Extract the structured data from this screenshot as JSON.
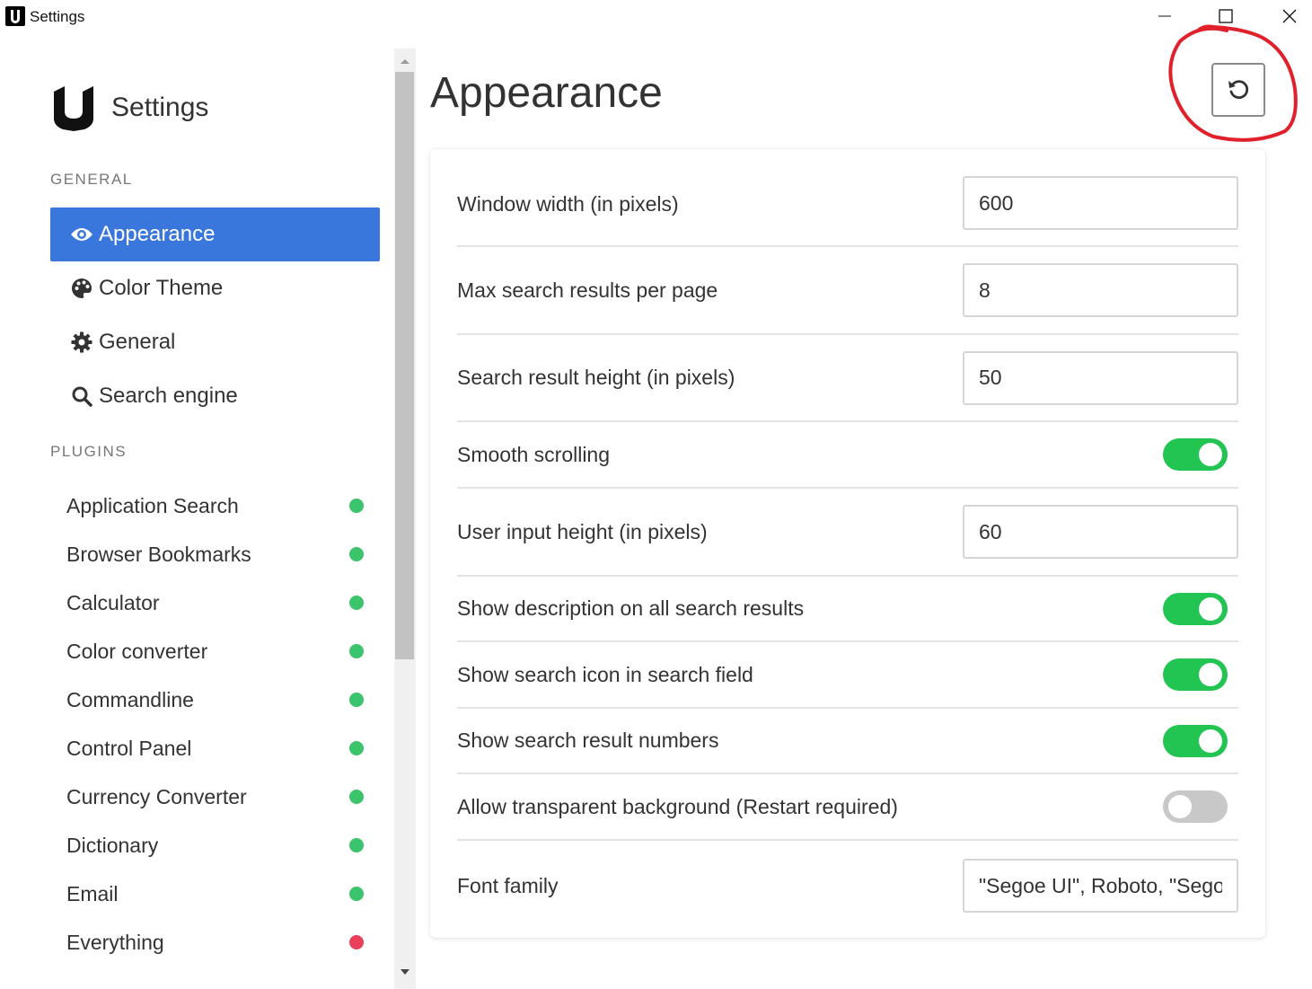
{
  "window": {
    "title": "Settings"
  },
  "sidebar": {
    "brand": "Settings",
    "general_label": "GENERAL",
    "plugins_label": "PLUGINS",
    "nav": [
      {
        "label": "Appearance",
        "icon": "eye-icon",
        "active": true
      },
      {
        "label": "Color Theme",
        "icon": "palette-icon",
        "active": false
      },
      {
        "label": "General",
        "icon": "gear-icon",
        "active": false
      },
      {
        "label": "Search engine",
        "icon": "search-icon",
        "active": false
      }
    ],
    "plugins": [
      {
        "label": "Application Search",
        "status": "enabled"
      },
      {
        "label": "Browser Bookmarks",
        "status": "enabled"
      },
      {
        "label": "Calculator",
        "status": "enabled"
      },
      {
        "label": "Color converter",
        "status": "enabled"
      },
      {
        "label": "Commandline",
        "status": "enabled"
      },
      {
        "label": "Control Panel",
        "status": "enabled"
      },
      {
        "label": "Currency Converter",
        "status": "enabled"
      },
      {
        "label": "Dictionary",
        "status": "enabled"
      },
      {
        "label": "Email",
        "status": "enabled"
      },
      {
        "label": "Everything",
        "status": "disabled"
      }
    ]
  },
  "main": {
    "title": "Appearance",
    "settings": [
      {
        "label": "Window width (in pixels)",
        "type": "input",
        "value": "600"
      },
      {
        "label": "Max search results per page",
        "type": "input",
        "value": "8"
      },
      {
        "label": "Search result height (in pixels)",
        "type": "input",
        "value": "50"
      },
      {
        "label": "Smooth scrolling",
        "type": "toggle",
        "on": true
      },
      {
        "label": "User input height (in pixels)",
        "type": "input",
        "value": "60"
      },
      {
        "label": "Show description on all search results",
        "type": "toggle",
        "on": true
      },
      {
        "label": "Show search icon in search field",
        "type": "toggle",
        "on": true
      },
      {
        "label": "Show search result numbers",
        "type": "toggle",
        "on": true
      },
      {
        "label": "Allow transparent background (Restart required)",
        "type": "toggle",
        "on": false
      },
      {
        "label": "Font family",
        "type": "input",
        "value": "\"Segoe UI\", Roboto, \"Segoe"
      }
    ]
  },
  "colors": {
    "accent": "#3a77dd",
    "enabled": "#3cc46c",
    "disabled": "#e8405a",
    "toggle_on": "#23c552",
    "toggle_off": "#c8c8c8",
    "annotation": "#e0202a"
  }
}
